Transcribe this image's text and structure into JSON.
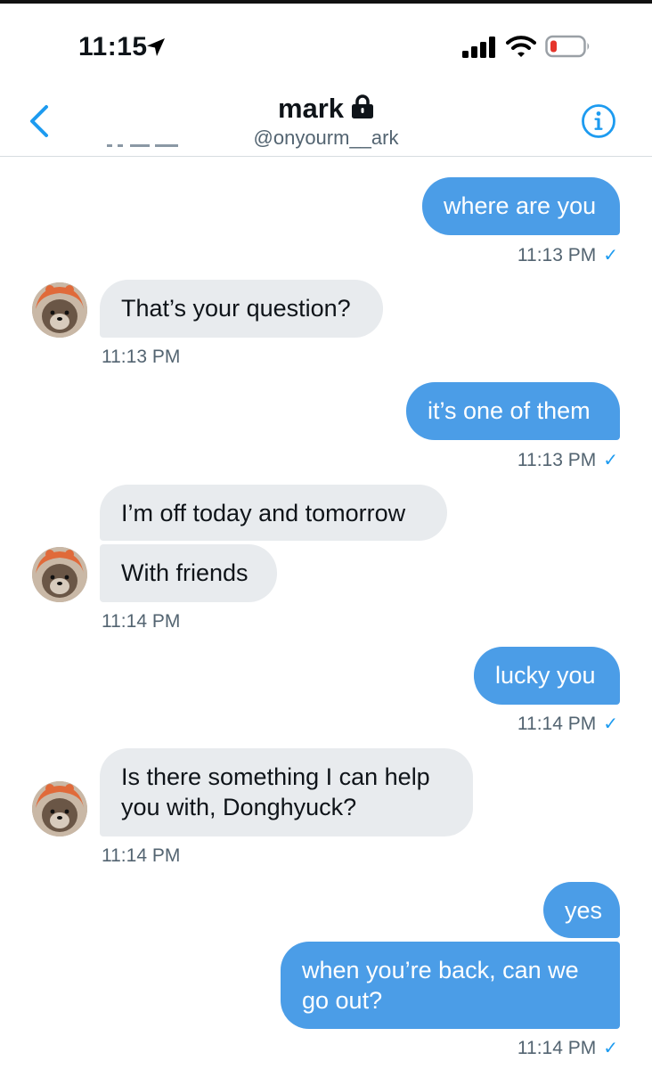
{
  "status_bar": {
    "time": "11:15"
  },
  "header": {
    "name": "mark",
    "handle": "@onyourm__ark"
  },
  "messages": {
    "m1": {
      "text": "where are you",
      "time": "11:13 PM"
    },
    "m2": {
      "text": "That’s your question?",
      "time": "11:13 PM"
    },
    "m3": {
      "text": "it’s one of them",
      "time": "11:13 PM"
    },
    "m4": {
      "text": "I’m off today and tomorrow"
    },
    "m5": {
      "text": "With friends",
      "time": "11:14 PM"
    },
    "m6": {
      "text": "lucky you",
      "time": "11:14 PM"
    },
    "m7": {
      "line1": "Is there something I can help",
      "line2": "you with, Donghyuck?",
      "time": "11:14 PM"
    },
    "m8": {
      "text": "yes"
    },
    "m9": {
      "line1": "when you’re back, can we",
      "line2": "go out?",
      "time": "11:14 PM"
    }
  },
  "read_check": "✓",
  "colors": {
    "accent": "#1d9bf0",
    "sent_bubble": "#4b9de7",
    "received_bubble": "#e8ebee",
    "battery_low": "#e5342b"
  }
}
